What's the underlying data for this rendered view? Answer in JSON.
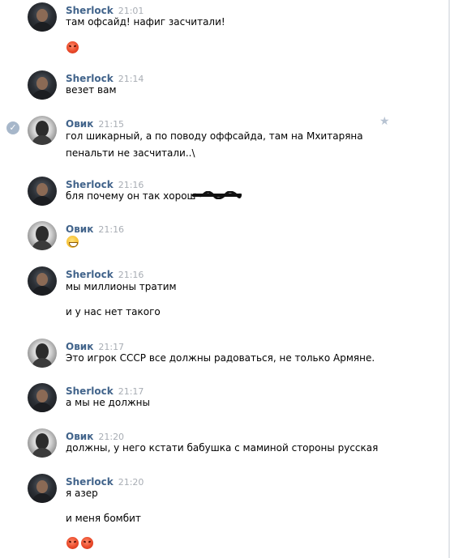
{
  "messages": [
    {
      "author": "Sherlock",
      "time": "21:01",
      "lines": [
        "там офсайд! нафиг засчитали!"
      ],
      "emoji": [
        "angry"
      ]
    },
    {
      "author": "Sherlock",
      "time": "21:14",
      "lines": [
        "везет вам"
      ]
    },
    {
      "author": "Овик",
      "time": "21:15",
      "lines": [
        "гол шикарный, а по поводу оффсайда, там на Мхитаряна",
        "пенальти не засчитали..\\"
      ]
    },
    {
      "author": "Sherlock",
      "time": "21:16",
      "lines": [
        "бля почему он так хорош"
      ]
    },
    {
      "author": "Овик",
      "time": "21:16",
      "lines": [],
      "emoji": [
        "grin"
      ]
    },
    {
      "author": "Sherlock",
      "time": "21:16",
      "lines": [
        "мы миллионы тратим",
        "и у нас нет такого"
      ]
    },
    {
      "author": "Овик",
      "time": "21:17",
      "lines": [
        "Это игрок СССР все должны радоваться, не только Армяне."
      ]
    },
    {
      "author": "Sherlock",
      "time": "21:17",
      "lines": [
        "а мы не должны"
      ]
    },
    {
      "author": "Овик",
      "time": "21:20",
      "lines": [
        "должны, у него кстати бабушка с маминой стороны русская"
      ]
    },
    {
      "author": "Sherlock",
      "time": "21:20",
      "lines": [
        "я азер",
        "и меня бомбит"
      ],
      "emoji": [
        "angry",
        "angry"
      ]
    }
  ],
  "icons": {
    "selected": "checkmark-icon",
    "favorite": "star-icon"
  },
  "colors": {
    "author": "#42648b",
    "time": "#a8adb4",
    "text": "#000000"
  }
}
